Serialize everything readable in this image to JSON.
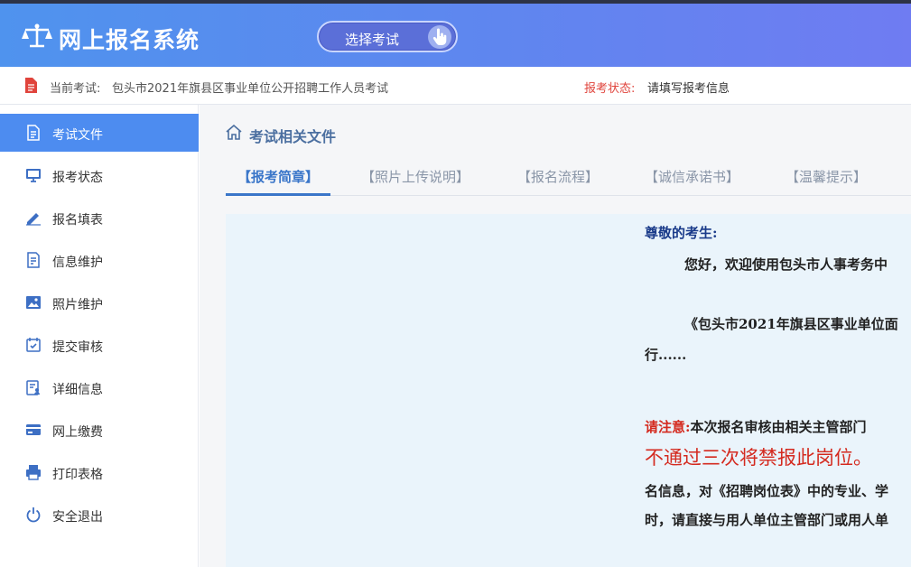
{
  "header": {
    "app_title": "网上报名系统",
    "exam_select_label": "选择考试"
  },
  "infobar": {
    "current_exam_label": "当前考试:",
    "current_exam_value": "包头市2021年旗县区事业单位公开招聘工作人员考试",
    "status_label": "报考状态:",
    "status_value": "请填写报考信息"
  },
  "sidebar": {
    "items": [
      {
        "label": "考试文件",
        "icon": "document-icon",
        "active": true
      },
      {
        "label": "报考状态",
        "icon": "monitor-icon"
      },
      {
        "label": "报名填表",
        "icon": "pen-icon"
      },
      {
        "label": "信息维护",
        "icon": "doc-edit-icon"
      },
      {
        "label": "照片维护",
        "icon": "image-icon"
      },
      {
        "label": "提交审核",
        "icon": "calendar-check-icon"
      },
      {
        "label": "详细信息",
        "icon": "profile-icon"
      },
      {
        "label": "网上缴费",
        "icon": "card-icon"
      },
      {
        "label": "打印表格",
        "icon": "printer-icon"
      },
      {
        "label": "安全退出",
        "icon": "power-icon"
      }
    ]
  },
  "main": {
    "section_title": "考试相关文件",
    "tabs": [
      {
        "label": "【报考简章】",
        "active": true
      },
      {
        "label": "【照片上传说明】"
      },
      {
        "label": "【报名流程】"
      },
      {
        "label": "【诚信承诺书】"
      },
      {
        "label": "【温馨提示】"
      }
    ],
    "doc": {
      "greeting": "尊敬的考生:",
      "line1": "您好，欢迎使用包头市人事考务中",
      "line2": "《包头市2021年旗县区事业单位面",
      "line3": "行......",
      "notice_label": "请注意:",
      "notice_text": "本次报名审核由相关主管部门",
      "notice_big": "不通过三次将禁报此岗位。",
      "line4": "名信息，对《招聘岗位表》中的专业、学",
      "line5": "时，请直接与用人单位主管部门或用人单"
    }
  },
  "colors": {
    "header_gradient_start": "#4f93ee",
    "header_gradient_end": "#6f7cf2",
    "active_nav": "#4d8cf0",
    "status_red": "#e0443c",
    "tab_active": "#3a76c9",
    "content_bg": "#eaf4fb"
  }
}
